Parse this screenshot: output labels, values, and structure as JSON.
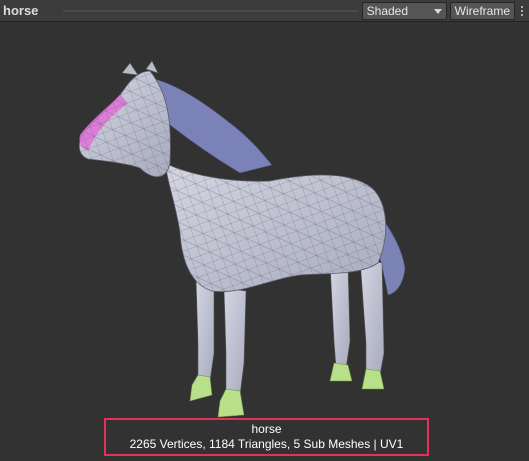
{
  "window": {
    "title": "horse"
  },
  "toolbar": {
    "shading_mode": "Shaded",
    "wireframe_label": "Wireframe",
    "menu_icon": "kebab-menu-icon"
  },
  "preview": {
    "mesh_name": "horse",
    "stats": "2265 Vertices, 1184 Triangles, 5 Sub Meshes | UV1"
  },
  "colors": {
    "background": "#323232",
    "toolbar": "#3c3c3c",
    "highlight_border": "#e0325a",
    "mesh_body": "#c9cbd6",
    "mane": "#7a82b8",
    "hooves": "#b8e08a",
    "muzzle": "#e070d8"
  }
}
